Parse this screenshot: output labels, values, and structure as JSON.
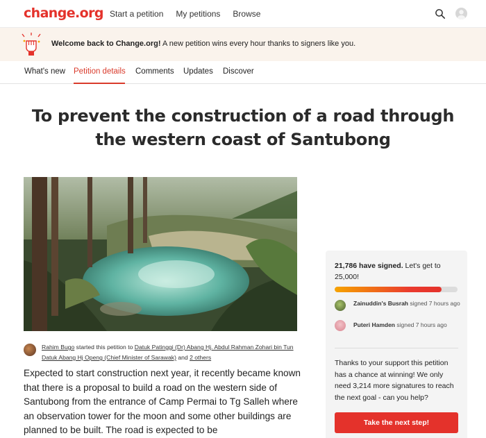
{
  "header": {
    "logo": "change.org",
    "nav": [
      "Start a petition",
      "My petitions",
      "Browse"
    ],
    "search_icon": "search-icon",
    "avatar_icon": "user-avatar-icon"
  },
  "banner": {
    "bold": "Welcome back to Change.org!",
    "text": " A new petition wins every hour thanks to signers like you.",
    "icon": "raised-fist-icon"
  },
  "tabs": [
    {
      "label": "What's new",
      "active": false
    },
    {
      "label": "Petition details",
      "active": true
    },
    {
      "label": "Comments",
      "active": false
    },
    {
      "label": "Updates",
      "active": false
    },
    {
      "label": "Discover",
      "active": false
    }
  ],
  "petition": {
    "title": "To prevent the construction of a road through the western coast of Santubong",
    "starter_name": "Rahim Bugo",
    "starter_mid": " started this petition to ",
    "target": "Datuk Patinggi (Dr) Abang Hj. Abdul Rahman Zohari bin Tun Datuk Abang Hj Openg (Chief Minister of Sarawak)",
    "starter_and": " and ",
    "others": "2 others",
    "body": "Expected to start construction next year, it recently became known that there is a proposal to build a road on the western side of Santubong from the entrance of Camp Permai to Tg Salleh where an observation tower for the moon and some other buildings are planned to be built. The road is expected to be"
  },
  "sign_card": {
    "count_bold": "21,786 have signed.",
    "goal_text": " Let's get to 25,000!",
    "progress_fraction": 0.8714,
    "signers": [
      {
        "name": "Zainuddin's Busrah",
        "action": " signed 7 hours ago"
      },
      {
        "name": "Puteri Hamden",
        "action": " signed 7 hours ago"
      }
    ],
    "message": "Thanks to your support this petition has a chance at winning! We only need 3,214 more signatures to reach the next goal - can you help?",
    "cta_label": "Take the next step!"
  },
  "colors": {
    "brand": "#e4322b",
    "active_tab": "#d93a2b",
    "banner_bg": "#faf3ec",
    "card_bg": "#f4f4f4"
  }
}
